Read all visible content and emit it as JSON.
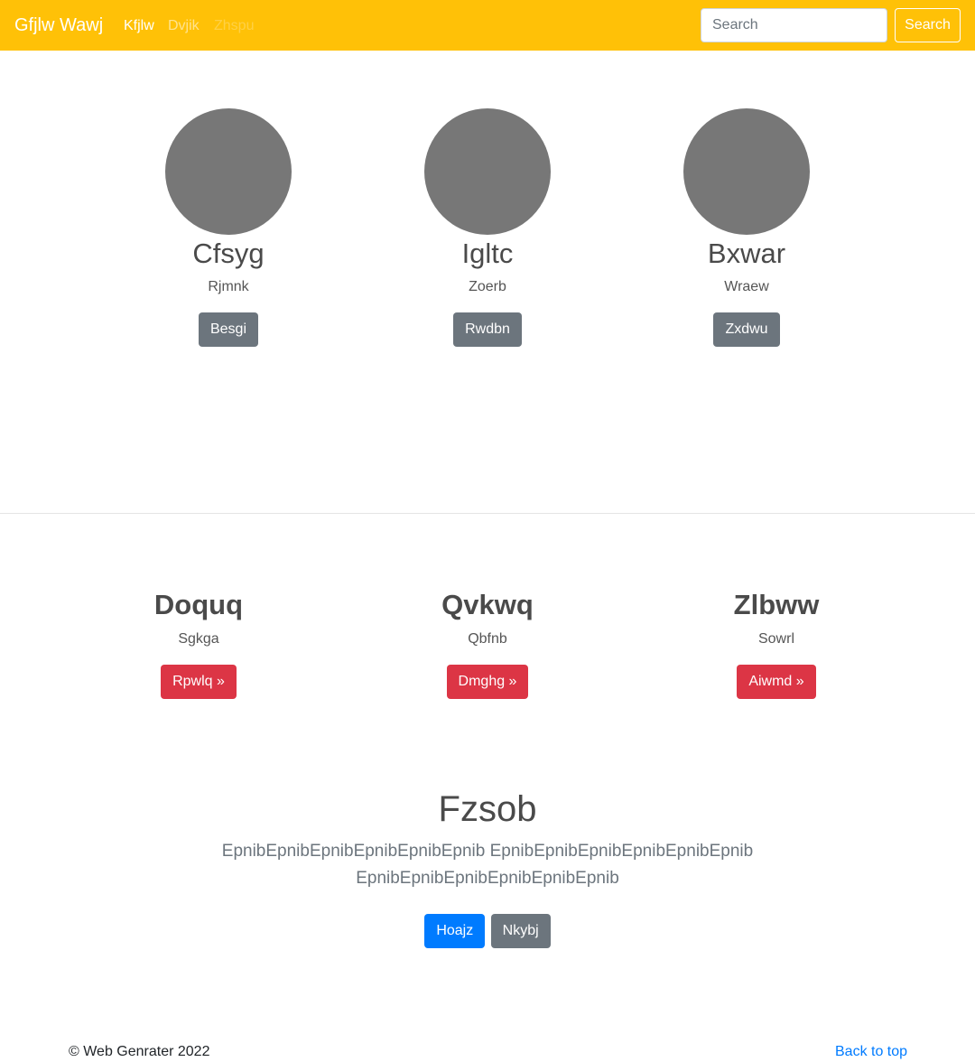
{
  "navbar": {
    "brand": "Gfjlw Wawj",
    "links": [
      "Kfjlw",
      "Dvjik",
      "Zhspu"
    ],
    "search_placeholder": "Search",
    "search_button": "Search",
    "background": "#ffc107"
  },
  "profiles": [
    {
      "name": "Cfsyg",
      "subtitle": "Rjmnk",
      "button": "Besgi"
    },
    {
      "name": "Igltc",
      "subtitle": "Zoerb",
      "button": "Rwdbn"
    },
    {
      "name": "Bxwar",
      "subtitle": "Wraew",
      "button": "Zxdwu"
    }
  ],
  "features": [
    {
      "title": "Doquq",
      "subtitle": "Sgkga",
      "button": "Rpwlq »"
    },
    {
      "title": "Qvkwq",
      "subtitle": "Qbfnb",
      "button": "Dmghg »"
    },
    {
      "title": "Zlbww",
      "subtitle": "Sowrl",
      "button": "Aiwmd »"
    }
  ],
  "hero": {
    "title": "Fzsob",
    "text": "EpnibEpnibEpnibEpnibEpnibEpnib EpnibEpnibEpnibEpnibEpnibEpnib EpnibEpnibEpnibEpnibEpnibEpnib",
    "primary_button": "Hoajz",
    "secondary_button": "Nkybj"
  },
  "footer": {
    "copyright": "© Web Genrater 2022",
    "back_to_top": "Back to top"
  },
  "colors": {
    "primary": "#007bff",
    "secondary": "#6c757d",
    "danger": "#dc3545",
    "warning": "#ffc107",
    "avatar": "#777777"
  }
}
